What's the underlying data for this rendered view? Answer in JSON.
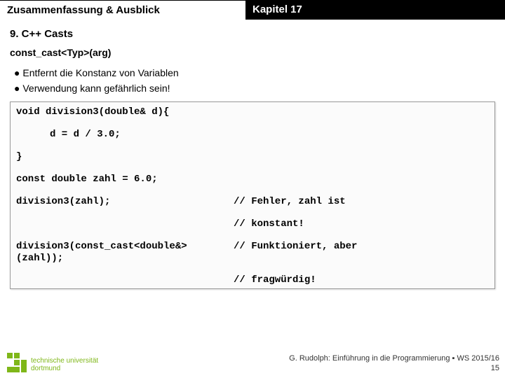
{
  "header": {
    "left": "Zusammenfassung & Ausblick",
    "right": "Kapitel 17"
  },
  "section_title": "9. C++ Casts",
  "subtitle": "const_cast<Typ>(arg)",
  "bullets": [
    "Entfernt die Konstanz von Variablen",
    "Verwendung kann gefährlich sein!"
  ],
  "code": {
    "l1": "void division3(double& d){",
    "l2": "d = d / 3.0;",
    "l3": "}",
    "l4": "const double zahl = 6.0;",
    "l5_left": "division3(zahl);",
    "l5_right": "// Fehler, zahl ist",
    "l6_right": "// konstant!",
    "l7_left": "division3(const_cast<double&>(zahl));",
    "l7_right": "// Funktioniert, aber",
    "l8_right": "// fragwürdig!"
  },
  "footer": {
    "uni_line1": "technische universität",
    "uni_line2": "dortmund",
    "credit": "G. Rudolph: Einführung in die Programmierung ▪ WS 2015/16",
    "page": "15"
  }
}
